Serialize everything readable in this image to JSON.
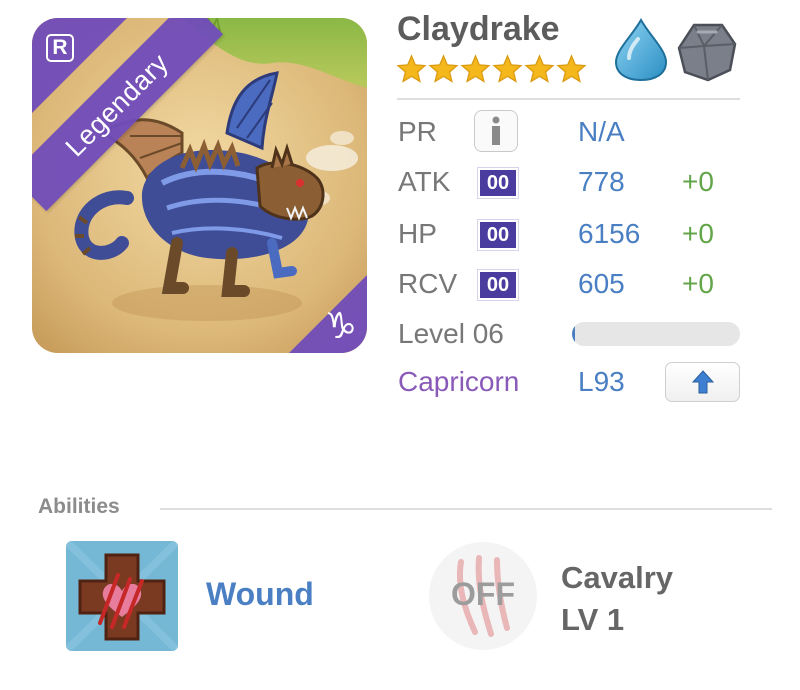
{
  "creature": {
    "name": "Claydrake",
    "rarity": "Legendary",
    "badge": "R",
    "zodiac_glyph": "♑",
    "stars": 6,
    "elements": [
      "water-element-icon",
      "earth-element-icon"
    ]
  },
  "stats": {
    "pr": {
      "label": "PR",
      "value": "N/A"
    },
    "atk": {
      "label": "ATK",
      "badge": "00",
      "value": "778",
      "bonus": "+0"
    },
    "hp": {
      "label": "HP",
      "badge": "00",
      "value": "6156",
      "bonus": "+0"
    },
    "rcv": {
      "label": "RCV",
      "badge": "00",
      "value": "605",
      "bonus": "+0"
    },
    "level": {
      "label": "Level 06",
      "progress": 0.02
    },
    "sign": {
      "label": "Capricorn",
      "level_cap": "L93"
    }
  },
  "abilities": {
    "title": "Abilities",
    "items": [
      {
        "name": "Wound",
        "icon": "wound-ability-icon"
      }
    ],
    "skill": {
      "state": "OFF",
      "name": "Cavalry",
      "level": "LV 1",
      "icon": "claw-skill-icon"
    }
  },
  "colors": {
    "accent_blue": "#4a7fc3",
    "bonus_green": "#63a64a",
    "legendary_purple": "#704cba",
    "sign_purple": "#8a5ab8",
    "star_gold": "#f5b81c"
  }
}
